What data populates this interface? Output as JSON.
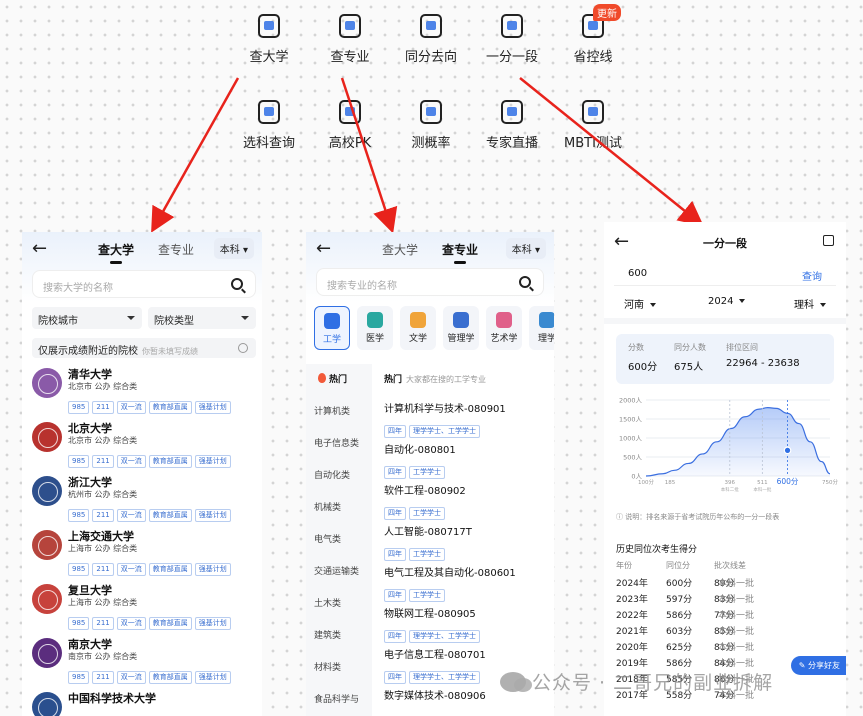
{
  "features": [
    {
      "label": "查大学",
      "icon": "building-icon"
    },
    {
      "label": "查专业",
      "icon": "book-icon"
    },
    {
      "label": "同分去向",
      "icon": "compass-icon"
    },
    {
      "label": "一分一段",
      "icon": "chart-card-icon"
    },
    {
      "label": "省控线",
      "icon": "monitor-icon",
      "badge": "更新"
    },
    {
      "label": "选科查询",
      "icon": "checklist-icon"
    },
    {
      "label": "高校PK",
      "icon": "versus-icon"
    },
    {
      "label": "测概率",
      "icon": "pie-icon"
    },
    {
      "label": "专家直播",
      "icon": "video-icon"
    },
    {
      "label": "MBTI测试",
      "icon": "test-icon"
    }
  ],
  "uni_panel": {
    "tab_active": "查大学",
    "tab_other": "查专业",
    "level": "本科",
    "search_placeholder": "搜索大学的名称",
    "filter_city": "院校城市",
    "filter_type": "院校类型",
    "nearby_label": "仅展示成绩附近的院校",
    "nearby_sub": "你暂未填写成绩",
    "universities": [
      {
        "name": "清华大学",
        "meta": "北京市  公办  综合类",
        "tags": [
          "985",
          "211",
          "双一流",
          "教育部直属",
          "强基计划"
        ],
        "color": "#8a5aa8"
      },
      {
        "name": "北京大学",
        "meta": "北京市  公办  综合类",
        "tags": [
          "985",
          "211",
          "双一流",
          "教育部直属",
          "强基计划"
        ],
        "color": "#b8322e"
      },
      {
        "name": "浙江大学",
        "meta": "杭州市  公办  综合类",
        "tags": [
          "985",
          "211",
          "双一流",
          "教育部直属",
          "强基计划"
        ],
        "color": "#2d4f8c"
      },
      {
        "name": "上海交通大学",
        "meta": "上海市  公办  综合类",
        "tags": [
          "985",
          "211",
          "双一流",
          "教育部直属",
          "强基计划"
        ],
        "color": "#b6443c"
      },
      {
        "name": "复旦大学",
        "meta": "上海市  公办  综合类",
        "tags": [
          "985",
          "211",
          "双一流",
          "教育部直属",
          "强基计划"
        ],
        "color": "#c7423c"
      },
      {
        "name": "南京大学",
        "meta": "南京市  公办  综合类",
        "tags": [
          "985",
          "211",
          "双一流",
          "教育部直属",
          "强基计划"
        ],
        "color": "#5b2d7e"
      },
      {
        "name": "中国科学技术大学",
        "meta": "",
        "tags": [],
        "color": "#2a4f8e"
      }
    ]
  },
  "major_panel": {
    "tab_other": "查大学",
    "tab_active": "查专业",
    "level": "本科",
    "search_placeholder": "搜索专业的名称",
    "categories": [
      "工学",
      "医学",
      "文学",
      "管理学",
      "艺术学",
      "理学"
    ],
    "sidebar": [
      "热门",
      "计算机类",
      "电子信息类",
      "自动化类",
      "机械类",
      "电气类",
      "交通运输类",
      "土木类",
      "建筑类",
      "材料类",
      "食品科学与"
    ],
    "hot_title": "热门",
    "hot_sub": "大家都在搜的工学专业",
    "majors": [
      {
        "name": "计算机科学与技术-080901",
        "tags": [
          "四年",
          "理学学士、工学学士"
        ]
      },
      {
        "name": "自动化-080801",
        "tags": [
          "四年",
          "工学学士"
        ]
      },
      {
        "name": "软件工程-080902",
        "tags": [
          "四年",
          "工学学士"
        ]
      },
      {
        "name": "人工智能-080717T",
        "tags": [
          "四年",
          "工学学士"
        ]
      },
      {
        "name": "电气工程及其自动化-080601",
        "tags": [
          "四年",
          "工学学士"
        ]
      },
      {
        "name": "物联网工程-080905",
        "tags": [
          "四年",
          "理学学士、工学学士"
        ]
      },
      {
        "name": "电子信息工程-080701",
        "tags": [
          "四年",
          "理学学士、工学学士"
        ]
      },
      {
        "name": "数字媒体技术-080906",
        "tags": []
      }
    ]
  },
  "score_panel": {
    "title": "一分一段",
    "score_input": "600",
    "query_label": "查询",
    "province": "河南",
    "year": "2024",
    "subject": "理科",
    "stats": [
      {
        "label": "分数",
        "value": "600分"
      },
      {
        "label": "同分人数",
        "value": "675人"
      },
      {
        "label": "排位区间",
        "value": "22964 - 23638"
      }
    ],
    "note": "说明：排名来源于省考试院历年公布的一分一段表",
    "history_title": "历史同位次考生得分",
    "history_headers": [
      "年份",
      "同位分",
      "批次线差"
    ],
    "history": [
      {
        "year": "2024年",
        "score": "600分",
        "diff": "89分",
        "batch": "本科一批"
      },
      {
        "year": "2023年",
        "score": "597分",
        "diff": "83分",
        "batch": "本科一批"
      },
      {
        "year": "2022年",
        "score": "586分",
        "diff": "77分",
        "batch": "本科一批"
      },
      {
        "year": "2021年",
        "score": "603分",
        "diff": "85分",
        "batch": "本科一批"
      },
      {
        "year": "2020年",
        "score": "625分",
        "diff": "81分",
        "batch": "本科一批"
      },
      {
        "year": "2019年",
        "score": "586分",
        "diff": "84分",
        "batch": "本科一批"
      },
      {
        "year": "2018年",
        "score": "585分",
        "diff": "86分",
        "batch": "本科一批"
      },
      {
        "year": "2017年",
        "score": "558分",
        "diff": "74分",
        "batch": "本科一批"
      }
    ],
    "share_label": "分享好友"
  },
  "chart_data": {
    "type": "area",
    "y_ticks": [
      "2000人",
      "1500人",
      "1000人",
      "500人",
      "0人"
    ],
    "ylim": [
      0,
      2000
    ],
    "x_labels": [
      {
        "x": 100,
        "label": "100分"
      },
      {
        "x": 185,
        "label": "185"
      },
      {
        "x": 396,
        "label": "396",
        "sub": "本科二批"
      },
      {
        "x": 511,
        "label": "511",
        "sub": "本科一批"
      },
      {
        "x": 600,
        "label": "600分",
        "highlight": true
      },
      {
        "x": 750,
        "label": "750分"
      }
    ],
    "xlim": [
      100,
      750
    ],
    "curve": [
      [
        100,
        0
      ],
      [
        160,
        60
      ],
      [
        200,
        150
      ],
      [
        250,
        330
      ],
      [
        300,
        580
      ],
      [
        350,
        900
      ],
      [
        400,
        1250
      ],
      [
        450,
        1560
      ],
      [
        500,
        1760
      ],
      [
        530,
        1800
      ],
      [
        560,
        1780
      ],
      [
        600,
        675
      ],
      [
        600,
        1650
      ],
      [
        640,
        1380
      ],
      [
        680,
        900
      ],
      [
        720,
        380
      ],
      [
        750,
        60
      ]
    ],
    "marker": {
      "x": 600,
      "y": 675
    }
  },
  "watermark": "公众号 · 二哥兄的副业拆解"
}
